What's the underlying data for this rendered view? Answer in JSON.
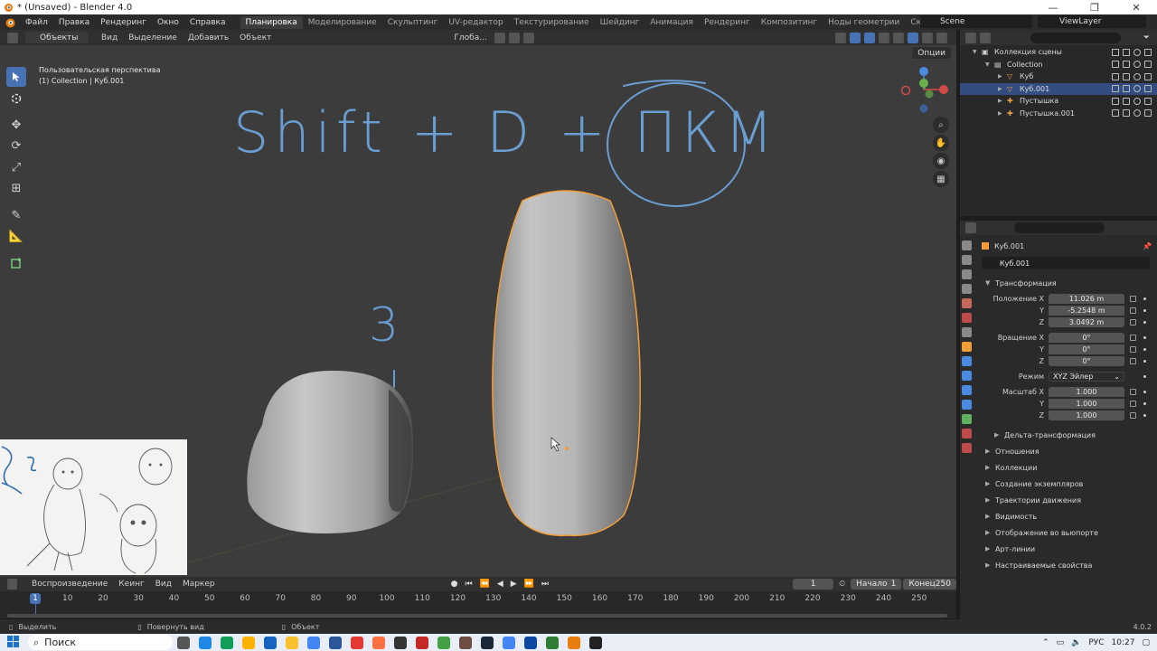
{
  "window": {
    "title": "* (Unsaved) - Blender 4.0",
    "minimize": "—",
    "maximize": "❐",
    "close": "✕"
  },
  "menu": [
    "Файл",
    "Правка",
    "Рендеринг",
    "Окно",
    "Справка"
  ],
  "workspaces": [
    "Планировка",
    "Моделирование",
    "Скульптинг",
    "UV-редактор",
    "Текстурирование",
    "Шейдинг",
    "Анимация",
    "Рендеринг",
    "Композитинг",
    "Ноды геометрии",
    "Скриптинг"
  ],
  "active_workspace": 0,
  "scene": "Scene",
  "view_layer": "ViewLayer",
  "viewport_header": {
    "mode": "Объекты",
    "items": [
      "Вид",
      "Выделение",
      "Добавить",
      "Объект"
    ],
    "orientation": "Глоба..."
  },
  "viewport": {
    "view_name": "Пользовательская перспектива",
    "context": "(1) Collection | Куб.001",
    "options": "Опции",
    "annotation_text": "Shift + D + ПКМ",
    "annotation_number": "3",
    "accent_color": "#4772b3",
    "selection_color": "#f29d3a",
    "annotation_color": "#6a9ed3"
  },
  "outliner": {
    "rows": [
      {
        "label": "Коллекция сцены",
        "indent": 0,
        "selected": false
      },
      {
        "label": "Collection",
        "indent": 1,
        "selected": false
      },
      {
        "label": "Куб",
        "indent": 2,
        "selected": false
      },
      {
        "label": "Куб.001",
        "indent": 2,
        "selected": true
      },
      {
        "label": "Пустышка",
        "indent": 2,
        "selected": false
      },
      {
        "label": "Пустышка.001",
        "indent": 2,
        "selected": false
      }
    ]
  },
  "properties": {
    "object_title": "Куб.001",
    "object_name": "Куб.001",
    "transform_section": "Трансформация",
    "location": {
      "label": "Положение X",
      "x": "11.026 m",
      "y": "-5.2548 m",
      "z": "3.0492 m"
    },
    "rotation": {
      "label": "Вращение X",
      "x": "0°",
      "y": "0°",
      "z": "0°"
    },
    "mode": {
      "label": "Режим",
      "value": "XYZ Эйлер"
    },
    "scale": {
      "label": "Масштаб X",
      "x": "1.000",
      "y": "1.000",
      "z": "1.000"
    },
    "axis_y": "Y",
    "axis_z": "Z",
    "delta": "Дельта-трансформация",
    "sections": [
      "Отношения",
      "Коллекции",
      "Создание экземпляров",
      "Траектории движения",
      "Видимость",
      "Отображение во вьюпорте",
      "Арт-линии",
      "Настраиваемые свойства"
    ]
  },
  "timeline": {
    "menus": [
      "Воспроизведение",
      "Кеинг",
      "Вид",
      "Маркер"
    ],
    "current_frame": "1",
    "start_label": "Начало",
    "start_value": "1",
    "end_label": "Конец",
    "end_value": "250",
    "ticks": [
      "10",
      "20",
      "30",
      "40",
      "50",
      "60",
      "70",
      "80",
      "90",
      "100",
      "110",
      "120",
      "130",
      "140",
      "150",
      "160",
      "170",
      "180",
      "190",
      "200",
      "210",
      "220",
      "230",
      "240",
      "250"
    ]
  },
  "status": {
    "select": "Выделить",
    "rotate": "Повернуть вид",
    "object": "Объект",
    "version": "4.0.2"
  },
  "taskbar": {
    "search": "Поиск",
    "lang": "РУС",
    "time": "10:27"
  }
}
